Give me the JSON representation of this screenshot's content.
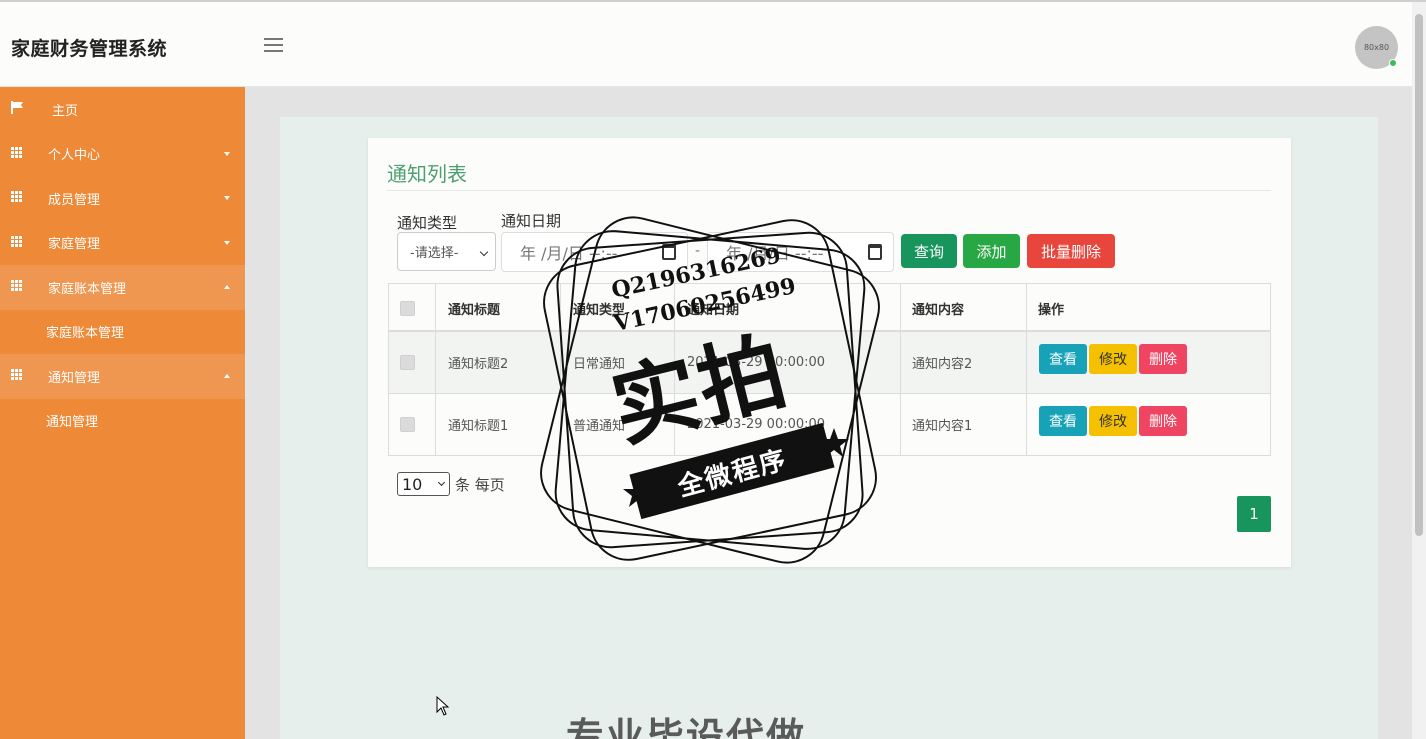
{
  "header": {
    "app_title": "家庭财务管理系统",
    "avatar_text": "80x80"
  },
  "sidebar": {
    "items": [
      {
        "label": "主页"
      },
      {
        "label": "个人中心"
      },
      {
        "label": "成员管理"
      },
      {
        "label": "家庭管理"
      },
      {
        "label": "家庭账本管理"
      },
      {
        "label": "家庭账本管理"
      },
      {
        "label": "通知管理"
      },
      {
        "label": "通知管理"
      }
    ]
  },
  "main": {
    "card_title": "通知列表",
    "filters": {
      "type_label": "通知类型",
      "type_value": "-请选择-",
      "date_label": "通知日期",
      "date_start_placeholder": "年 /月/日 --:--",
      "date_separator": "-",
      "date_end_placeholder": "年 /月/日 --:--"
    },
    "buttons": {
      "query": "查询",
      "add": "添加",
      "batch_delete": "批量删除"
    },
    "table": {
      "columns": [
        "通知标题",
        "通知类型",
        "通知日期",
        "通知内容",
        "操作"
      ],
      "rows": [
        {
          "title": "通知标题2",
          "type": "日常通知",
          "date": "2021-03-29 00:00:00",
          "content": "通知内容2"
        },
        {
          "title": "通知标题1",
          "type": "普通通知",
          "date": "2021-03-29 00:00:00",
          "content": "通知内容1"
        }
      ],
      "row_actions": {
        "view": "查看",
        "edit": "修改",
        "delete": "删除"
      }
    },
    "pagination": {
      "page_size": "10",
      "page_size_suffix": "条 每页",
      "current_page": "1"
    },
    "bottom_text": "专业毕设代做"
  },
  "watermark": {
    "line1": "Q2196316269",
    "line2": "V17060256499",
    "big": "实拍",
    "ribbon": "全微程序"
  },
  "colors": {
    "sidebar": "#ee8937",
    "title_green": "#4d9f70",
    "query": "#17955c",
    "add": "#28a745",
    "danger": "#e8453c",
    "view": "#17a2b8",
    "edit": "#f5c000",
    "delete": "#ef4562"
  }
}
